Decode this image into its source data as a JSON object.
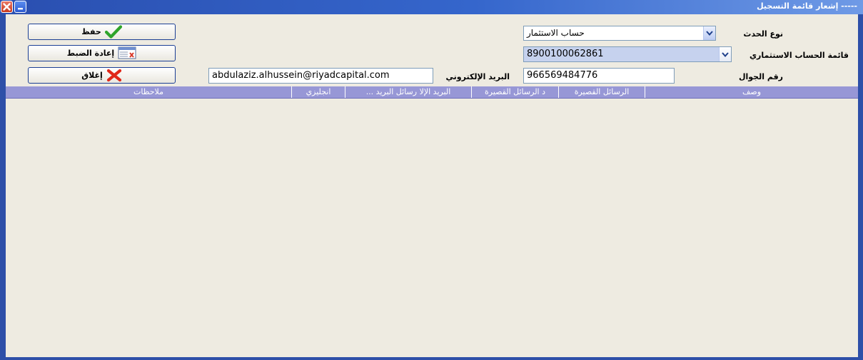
{
  "window": {
    "title": "----- إشعار قائمة التسجيل"
  },
  "buttons": {
    "save_label": "حفظ",
    "reset_label": "إعادة الضبط",
    "close_label": "إغلاق"
  },
  "form": {
    "event_type": {
      "label": "نوع الحدث",
      "value": "حساب الاستثمار"
    },
    "account_list": {
      "label": "قائمة الحساب الاستثماري",
      "value": "8900100062861"
    },
    "mobile": {
      "label": "رقم الجوال",
      "value": "966569484776"
    },
    "email": {
      "label": "البريد الإلكتروني",
      "value": "abdulaziz.alhussein@riyadcapital.com"
    }
  },
  "grid": {
    "columns": [
      "وصف",
      "الرسائل القصيرة",
      "د الرسائل القصيرة",
      "البريد الإلا رسائل البريد ...",
      "انجليزي",
      "ملاحظات"
    ],
    "rows": []
  },
  "colors": {
    "titlebar": "#3566cc",
    "window_bg": "#eeebe1",
    "grid_header": "#9797d6",
    "selected_combo": "#c6d2ee"
  }
}
